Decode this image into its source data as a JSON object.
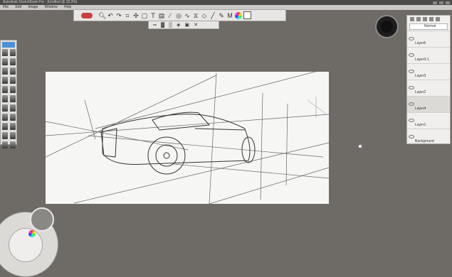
{
  "window": {
    "title": "Autodesk SketchBook Pro - [Untitled @ 33.3%]"
  },
  "menu": [
    "File",
    "Edit",
    "Image",
    "Window",
    "Help"
  ],
  "toolbar": {
    "icons": [
      "brush-icon",
      "zoom-icon",
      "undo-icon",
      "redo-icon",
      "crop-icon",
      "move-icon",
      "transform-icon",
      "text-icon",
      "type-icon",
      "ruler-icon",
      "ellipse-icon",
      "french-curve-icon",
      "symmetry-icon",
      "perspective-icon",
      "line-icon",
      "pen-icon",
      "color-editor-icon",
      "color-wheel-icon",
      "swatch-icon"
    ],
    "text_glyph": "T",
    "m_glyph": "M"
  },
  "subbar": {
    "icons": [
      "vanishing-point-icon",
      "horizon-icon",
      "grid-icon",
      "lock-icon",
      "snap-icon",
      "close-icon"
    ]
  },
  "layers": {
    "blend_mode": "Normal",
    "items": [
      "Layer5",
      "Layer3-1",
      "Layer3",
      "Layer2",
      "Layer4",
      "Layer1",
      "Background"
    ]
  },
  "accent": "#c94040"
}
